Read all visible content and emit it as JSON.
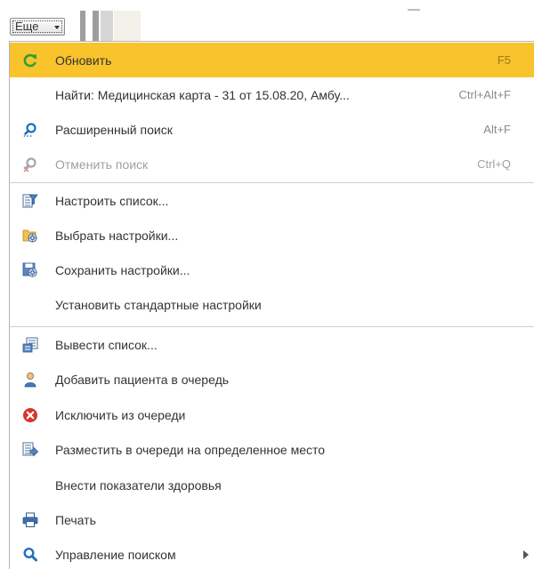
{
  "toolbar": {
    "more_label": "Еще"
  },
  "menu": {
    "items": [
      {
        "label": "Обновить",
        "shortcut": "F5"
      },
      {
        "label": "Найти: Медицинская карта - 31 от 15.08.20, Амбу...",
        "shortcut": "Ctrl+Alt+F"
      },
      {
        "label": "Расширенный поиск",
        "shortcut": "Alt+F"
      },
      {
        "label": "Отменить поиск",
        "shortcut": "Ctrl+Q"
      },
      {
        "label": "Настроить список..."
      },
      {
        "label": "Выбрать настройки..."
      },
      {
        "label": "Сохранить настройки..."
      },
      {
        "label": "Установить стандартные настройки"
      },
      {
        "label": "Вывести список..."
      },
      {
        "label": "Добавить пациента в очередь"
      },
      {
        "label": "Исключить из очереди"
      },
      {
        "label": "Разместить в очереди на определенное место"
      },
      {
        "label": "Внести показатели здоровья"
      },
      {
        "label": "Печать"
      },
      {
        "label": "Управление поиском"
      }
    ]
  },
  "icons": {
    "refresh": "refresh-icon",
    "advanced_search": "magnifier-icon",
    "cancel_search": "magnifier-cancel-icon",
    "configure_list": "list-filter-icon",
    "choose_settings": "folder-gear-icon",
    "save_settings": "floppy-gear-icon",
    "output_list": "list-output-icon",
    "add_patient": "person-icon",
    "remove_from_queue": "close-circle-icon",
    "place_in_queue": "list-arrow-icon",
    "print": "printer-icon",
    "search_control": "magnifier-icon"
  },
  "colors": {
    "highlight": "#f8c32b",
    "refresh_green": "#2e9e35",
    "search_blue": "#1f6fc0",
    "cancel_red": "#d9342b"
  }
}
